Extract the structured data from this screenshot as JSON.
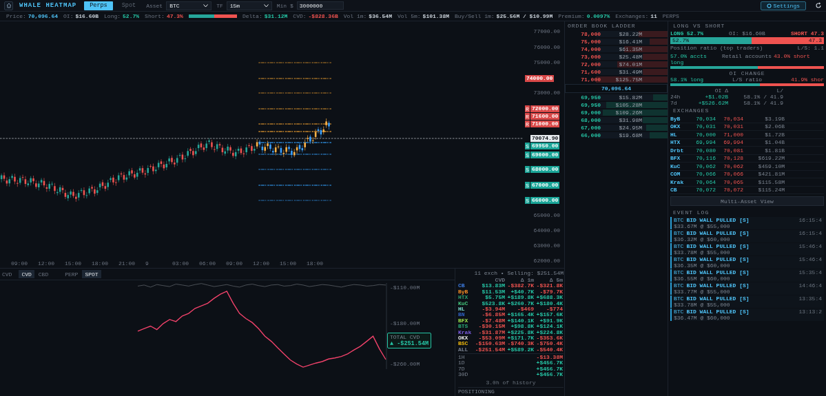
{
  "header": {
    "title": "WHALE HEATMAP",
    "tabs": [
      {
        "label": "Perps",
        "selected": true
      },
      {
        "label": "Spot",
        "selected": false
      }
    ],
    "asset": {
      "label": "Asset",
      "value": "BTC"
    },
    "timeframe": {
      "label": "TF",
      "value": "15m"
    },
    "min_size": {
      "label": "Min $",
      "value": "3000000"
    },
    "settings_button": "Settings"
  },
  "stats": [
    {
      "kind": "stat",
      "label": "Price:",
      "value": "70,096.64",
      "color": "#4fc3f7"
    },
    {
      "kind": "stat",
      "label": "OI:",
      "value": "$16.60B"
    },
    {
      "kind": "stat",
      "label": "Long:",
      "value": "52.7%",
      "color": "#26c6a6"
    },
    {
      "kind": "stat",
      "label": "Short:",
      "value": "47.3%",
      "color": "#ef5350"
    },
    {
      "kind": "bar",
      "level": 0.527
    },
    {
      "kind": "stat",
      "label": "Delta:",
      "value": "$31.12M",
      "color": "#26c6a6"
    },
    {
      "kind": "stat",
      "label": "CVD:",
      "value": "-$828.36B",
      "color": "#ef5350"
    },
    {
      "kind": "stat",
      "label": "Vol 1m:",
      "value": "$36.54M"
    },
    {
      "kind": "stat",
      "label": "Vol 5m:",
      "value": "$101.38M"
    },
    {
      "kind": "stat",
      "label": "Buy/Sell 1m:",
      "value": "$25.56M / $10.99M"
    },
    {
      "kind": "stat",
      "label": "Premium:",
      "value": "0.0097%",
      "color": "#26c6a6"
    },
    {
      "kind": "stat",
      "label": "Exchanges:",
      "value": "11"
    },
    {
      "kind": "tag",
      "label": "PERPS"
    }
  ],
  "price_chart": {
    "price_axis": [
      {
        "kind": "tick",
        "text": "77000.00"
      },
      {
        "kind": "tick",
        "text": "76000.00"
      },
      {
        "kind": "tick",
        "text": "75000.00"
      },
      {
        "kind": "resistance",
        "text": "74000.00"
      },
      {
        "kind": "tick",
        "text": "73000.00"
      },
      {
        "kind": "resistance",
        "badge": "R",
        "text": "72000.00"
      },
      {
        "kind": "resistance",
        "badge": "R",
        "text": "71600.00"
      },
      {
        "kind": "resistance",
        "badge": "R",
        "text": "71000.00"
      },
      {
        "kind": "current",
        "text": "70074.90"
      },
      {
        "kind": "support",
        "badge": "S",
        "text": "69950.00"
      },
      {
        "kind": "support",
        "badge": "S",
        "text": "69000.00"
      },
      {
        "kind": "support",
        "badge": "S",
        "text": "68000.00"
      },
      {
        "kind": "support",
        "badge": "S",
        "text": "67000.00"
      },
      {
        "kind": "support",
        "badge": "S",
        "text": "66000.00"
      },
      {
        "kind": "tick",
        "text": "65000.00"
      },
      {
        "kind": "tick",
        "text": "64000.00"
      },
      {
        "kind": "tick",
        "text": "63000.00"
      },
      {
        "kind": "tick",
        "text": "62000.00"
      }
    ],
    "time_axis": [
      "09:00",
      "12:00",
      "15:00",
      "18:00",
      "21:00",
      "9",
      "03:00",
      "06:00",
      "09:00",
      "12:00",
      "15:00",
      "18:00"
    ]
  },
  "cvd_panel": {
    "label": "CVD",
    "modes": [
      {
        "label": "CVD",
        "selected": true
      },
      {
        "label": "CBD",
        "selected": false
      }
    ],
    "markets": [
      {
        "label": "PERP",
        "selected": false
      },
      {
        "label": "SPOT",
        "selected": true
      }
    ],
    "chart_data": {
      "type": "line",
      "ylim": [
        -270,
        -100
      ],
      "yticks": [
        {
          "value": -110,
          "label": "-$110.00M"
        },
        {
          "value": -180,
          "label": "-$180.00M"
        },
        {
          "value": -260,
          "label": "-$260.00M"
        }
      ],
      "series": [
        {
          "color": "#f0426a",
          "values": [
            -195,
            -190,
            -185,
            -192,
            -180,
            -172,
            -176,
            -165,
            -160,
            -150,
            -145,
            -140,
            -130,
            -122,
            -116,
            -140,
            -160,
            -170,
            -178,
            -190,
            -205,
            -215,
            -228,
            -240,
            -252,
            -260,
            -266,
            -262,
            -258,
            -255,
            -250,
            -248,
            -245,
            -240,
            -232,
            -225,
            -215,
            -205,
            -230,
            -251
          ]
        },
        {
          "color": "#5a5f66",
          "values": [
            -106,
            -104,
            -108,
            -103,
            -105,
            -107,
            -102,
            -104,
            -106,
            -103,
            -101,
            -104,
            -107,
            -105,
            -103,
            -106,
            -108,
            -104,
            -102,
            -105,
            -107,
            -104,
            -103,
            -106,
            -105,
            -102,
            -104,
            -107,
            -105,
            -103,
            -104,
            -106,
            -108,
            -105,
            -103,
            -104,
            -106,
            -105,
            -103,
            -104
          ]
        }
      ]
    },
    "total": {
      "label": "TOTAL CVD",
      "value": "▲ -$251.54M"
    }
  },
  "cvd_table": {
    "summary": "11 exch • Selling: $251.54M",
    "columns": [
      "CVD",
      "Δ 1m",
      "Δ 5m"
    ],
    "rows": [
      {
        "exchange": "CB",
        "color": "#3d7be0",
        "cells": [
          {
            "text": "$13.83M",
            "negative": false
          },
          {
            "text": "-$382.7K",
            "negative": true
          },
          {
            "text": "-$321.8K",
            "negative": true
          }
        ]
      },
      {
        "exchange": "ByB",
        "color": "#f08a24",
        "cells": [
          {
            "text": "$11.53M",
            "negative": false
          },
          {
            "text": "+$40.7K",
            "negative": false
          },
          {
            "text": "-$79.7K",
            "negative": true
          }
        ]
      },
      {
        "exchange": "HTX",
        "color": "#2e9e6e",
        "cells": [
          {
            "text": "$5.75M",
            "negative": false
          },
          {
            "text": "+$189.8K",
            "negative": false
          },
          {
            "text": "+$688.3K",
            "negative": false
          }
        ]
      },
      {
        "exchange": "KuC",
        "color": "#43c47a",
        "cells": [
          {
            "text": "$523.8K",
            "negative": false
          },
          {
            "text": "+$260.7K",
            "negative": false
          },
          {
            "text": "+$180.4K",
            "negative": false
          }
        ]
      },
      {
        "exchange": "HL",
        "color": "#7fe0d0",
        "cells": [
          {
            "text": "-$3.94M",
            "negative": true
          },
          {
            "text": "-$469",
            "negative": true
          },
          {
            "text": "-$774",
            "negative": true
          }
        ]
      },
      {
        "exchange": "BN",
        "color": "#2f5fc0",
        "cells": [
          {
            "text": "-$6.85M",
            "negative": true
          },
          {
            "text": "+$165.4K",
            "negative": false
          },
          {
            "text": "+$157.6K",
            "negative": false
          }
        ]
      },
      {
        "exchange": "BFX",
        "color": "#9be04a",
        "cells": [
          {
            "text": "-$7.48M",
            "negative": true
          },
          {
            "text": "+$140.1K",
            "negative": false
          },
          {
            "text": "+$91.9K",
            "negative": false
          }
        ]
      },
      {
        "exchange": "BTS",
        "color": "#2aa876",
        "cells": [
          {
            "text": "-$30.15M",
            "negative": true
          },
          {
            "text": "+$98.8K",
            "negative": false
          },
          {
            "text": "+$124.1K",
            "negative": false
          }
        ]
      },
      {
        "exchange": "Krak",
        "color": "#7b5ce0",
        "cells": [
          {
            "text": "-$31.87M",
            "negative": true
          },
          {
            "text": "+$225.8K",
            "negative": false
          },
          {
            "text": "+$224.8K",
            "negative": false
          }
        ]
      },
      {
        "exchange": "OKX",
        "color": "#e6e6e6",
        "cells": [
          {
            "text": "-$53.09M",
            "negative": true
          },
          {
            "text": "+$171.7K",
            "negative": false
          },
          {
            "text": "-$353.6K",
            "negative": true
          }
        ]
      },
      {
        "exchange": "BSC",
        "color": "#f0b90b",
        "cells": [
          {
            "text": "-$150.63M",
            "negative": true
          },
          {
            "text": "-$740.3K",
            "negative": true
          },
          {
            "text": "-$750.4K",
            "negative": true
          }
        ]
      },
      {
        "exchange": "ALL",
        "color": "#7a8290",
        "cells": [
          {
            "text": "-$251.54M",
            "negative": true
          },
          {
            "text": "+$589.2K",
            "negative": false
          },
          {
            "text": "-$540.4K",
            "negative": true
          }
        ]
      }
    ],
    "windows": [
      {
        "label": "1H",
        "value": "-$13.38M",
        "negative": true
      },
      {
        "label": "1D",
        "value": "+$456.7K",
        "negative": false
      },
      {
        "label": "7D",
        "value": "+$456.7K",
        "negative": false
      },
      {
        "label": "30D",
        "value": "+$456.7K",
        "negative": false
      }
    ],
    "history_note": "3.0h of history",
    "footer": "POSITIONING"
  },
  "order_book": {
    "title": "ORDER BOOK LADDER",
    "asks": [
      {
        "price": "78,000",
        "size": "$28.22M",
        "level": 0.4
      },
      {
        "price": "75,000",
        "size": "$16.41M",
        "level": 0.25
      },
      {
        "price": "74,000",
        "size": "$61.35M",
        "level": 0.6
      },
      {
        "price": "73,000",
        "size": "$25.48M",
        "level": 0.35
      },
      {
        "price": "72,000",
        "size": "$74.01M",
        "level": 0.7
      },
      {
        "price": "71,600",
        "size": "$31.49M",
        "level": 0.35
      },
      {
        "price": "71,000",
        "size": "$125.75M",
        "level": 1.0
      }
    ],
    "mid_price": "70,096.64",
    "bids": [
      {
        "price": "69,950",
        "size": "$15.82M",
        "level": 0.2
      },
      {
        "price": "69,950",
        "size": "$105.28M",
        "level": 0.85
      },
      {
        "price": "69,000",
        "size": "$109.26M",
        "level": 0.9
      },
      {
        "price": "68,000",
        "size": "$31.98M",
        "level": 0.35
      },
      {
        "price": "67,000",
        "size": "$24.95M",
        "level": 0.3
      },
      {
        "price": "66,000",
        "size": "$19.68M",
        "level": 0.25
      }
    ]
  },
  "long_short": {
    "title": "LONG VS SHORT",
    "long": "LONG 52.7%",
    "oi": "OI: $16.60B",
    "short": "SHORT 47.3",
    "top_traders": {
      "long": "52.7%",
      "short": "47.3",
      "level": 0.527,
      "caption": "Position ratio (top traders)",
      "ratio": "L/S: 1.1"
    },
    "retail": {
      "long": "57.0% accts long",
      "middle": "Retail accounts",
      "short": "43.0% short",
      "level": 0.57
    },
    "oi_change": {
      "title": "OI CHANGE",
      "long": "58.1% long",
      "middle": "L/S ratio",
      "short": "41.9% shor",
      "level": 0.581,
      "columns": [
        "OI Δ",
        "L/"
      ],
      "rows": [
        {
          "period": "24h",
          "change": "+$1.02B",
          "ratio": "58.1% / 41.9"
        },
        {
          "period": "7d",
          "change": "+$526.62M",
          "ratio": "58.1% / 41.9"
        }
      ]
    }
  },
  "exchanges": {
    "title": "EXCHANGES",
    "rows": [
      {
        "name": "ByB",
        "bid": "70,034",
        "ask": "70,034",
        "oi": "$3.19B"
      },
      {
        "name": "OKX",
        "bid": "70,031",
        "ask": "70,031",
        "oi": "$2.06B"
      },
      {
        "name": "HL",
        "bid": "70,000",
        "ask": "71,000",
        "oi": "$1.72B"
      },
      {
        "name": "HTX",
        "bid": "69,994",
        "ask": "69,994",
        "oi": "$1.04B"
      },
      {
        "name": "Drbt",
        "bid": "70,080",
        "ask": "70,081",
        "oi": "$1.81B"
      },
      {
        "name": "BFX",
        "bid": "70,116",
        "ask": "70,128",
        "oi": "$619.22M"
      },
      {
        "name": "KuC",
        "bid": "70,062",
        "ask": "70,062",
        "oi": "$459.10M"
      },
      {
        "name": "COM",
        "bid": "70,066",
        "ask": "70,066",
        "oi": "$421.81M"
      },
      {
        "name": "Krak",
        "bid": "70,064",
        "ask": "70,065",
        "oi": "$115.58M"
      },
      {
        "name": "CB",
        "bid": "70,072",
        "ask": "70,072",
        "oi": "$115.24M"
      }
    ]
  },
  "multi_asset_button": "Multi-Asset View",
  "event_log": {
    "title": "EVENT LOG",
    "events": [
      {
        "asset": "BTC",
        "title": "BID WALL PULLED [S]",
        "detail": "$33.67M @ $55,000",
        "time": "16:15:4"
      },
      {
        "asset": "BTC",
        "title": "BID WALL PULLED [S]",
        "detail": "$36.32M @ $60,000",
        "time": "16:15:4"
      },
      {
        "asset": "BTC",
        "title": "BID WALL PULLED [S]",
        "detail": "$33.78M @ $55,000",
        "time": "15:46:4"
      },
      {
        "asset": "BTC",
        "title": "BID WALL PULLED [S]",
        "detail": "$36.35M @ $60,000",
        "time": "15:46:4"
      },
      {
        "asset": "BTC",
        "title": "BID WALL PULLED [S]",
        "detail": "$36.55M @ $60,000",
        "time": "15:35:4"
      },
      {
        "asset": "BTC",
        "title": "BID WALL PULLED [S]",
        "detail": "$33.77M @ $55,000",
        "time": "14:46:4"
      },
      {
        "asset": "BTC",
        "title": "BID WALL PULLED [S]",
        "detail": "$33.78M @ $55,000",
        "time": "13:35:4"
      },
      {
        "asset": "BTC",
        "title": "BID WALL PULLED [S]",
        "detail": "$36.47M @ $60,000",
        "time": "13:13:2"
      }
    ]
  }
}
